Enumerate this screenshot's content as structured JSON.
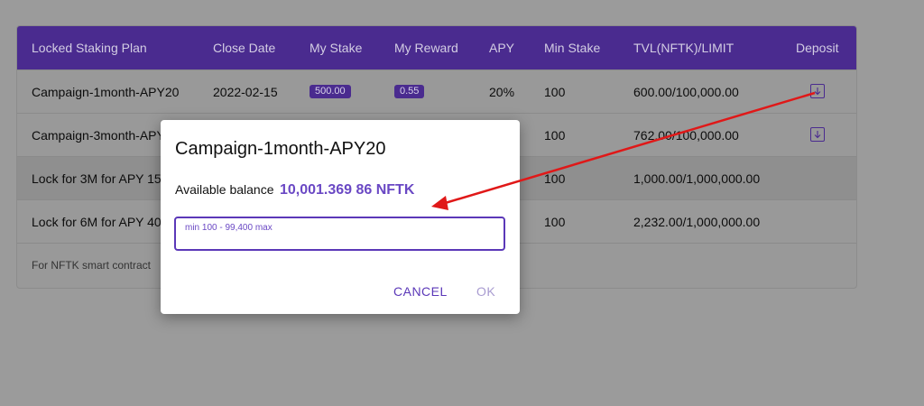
{
  "table": {
    "headers": {
      "plan": "Locked Staking Plan",
      "close_date": "Close Date",
      "my_stake": "My Stake",
      "my_reward": "My Reward",
      "apy": "APY",
      "min_stake": "Min Stake",
      "tvl": "TVL(NFTK)/LIMIT",
      "deposit": "Deposit"
    },
    "rows": [
      {
        "plan": "Campaign-1month-APY20",
        "close_date": "2022-02-15",
        "my_stake": "500.00",
        "my_reward": "0.55",
        "apy": "20%",
        "min_stake": "100",
        "tvl": "600.00/100,000.00"
      },
      {
        "plan": "Campaign-3month-APY",
        "min_stake": "100",
        "tvl": "762.00/100,000.00"
      },
      {
        "plan": "Lock for 3M for APY 15",
        "min_stake": "100",
        "tvl": "1,000.00/1,000,000.00"
      },
      {
        "plan": "Lock for 6M for APY 40",
        "min_stake": "100",
        "tvl": "2,232.00/1,000,000.00"
      }
    ],
    "footer_note": "For NFTK smart contract"
  },
  "dialog": {
    "title": "Campaign-1month-APY20",
    "balance_label": "Available balance",
    "balance_value": "10,001.369 86 NFTK",
    "input_placeholder": "min 100 - 99,400 max",
    "input_value": "",
    "cancel_label": "CANCEL",
    "ok_label": "OK"
  },
  "colors": {
    "accent": "#4a2b8f",
    "dialog_accent": "#5b38b8",
    "annotation_arrow": "#e01818"
  },
  "icons": {
    "deposit": "arrow-down-box-icon"
  }
}
